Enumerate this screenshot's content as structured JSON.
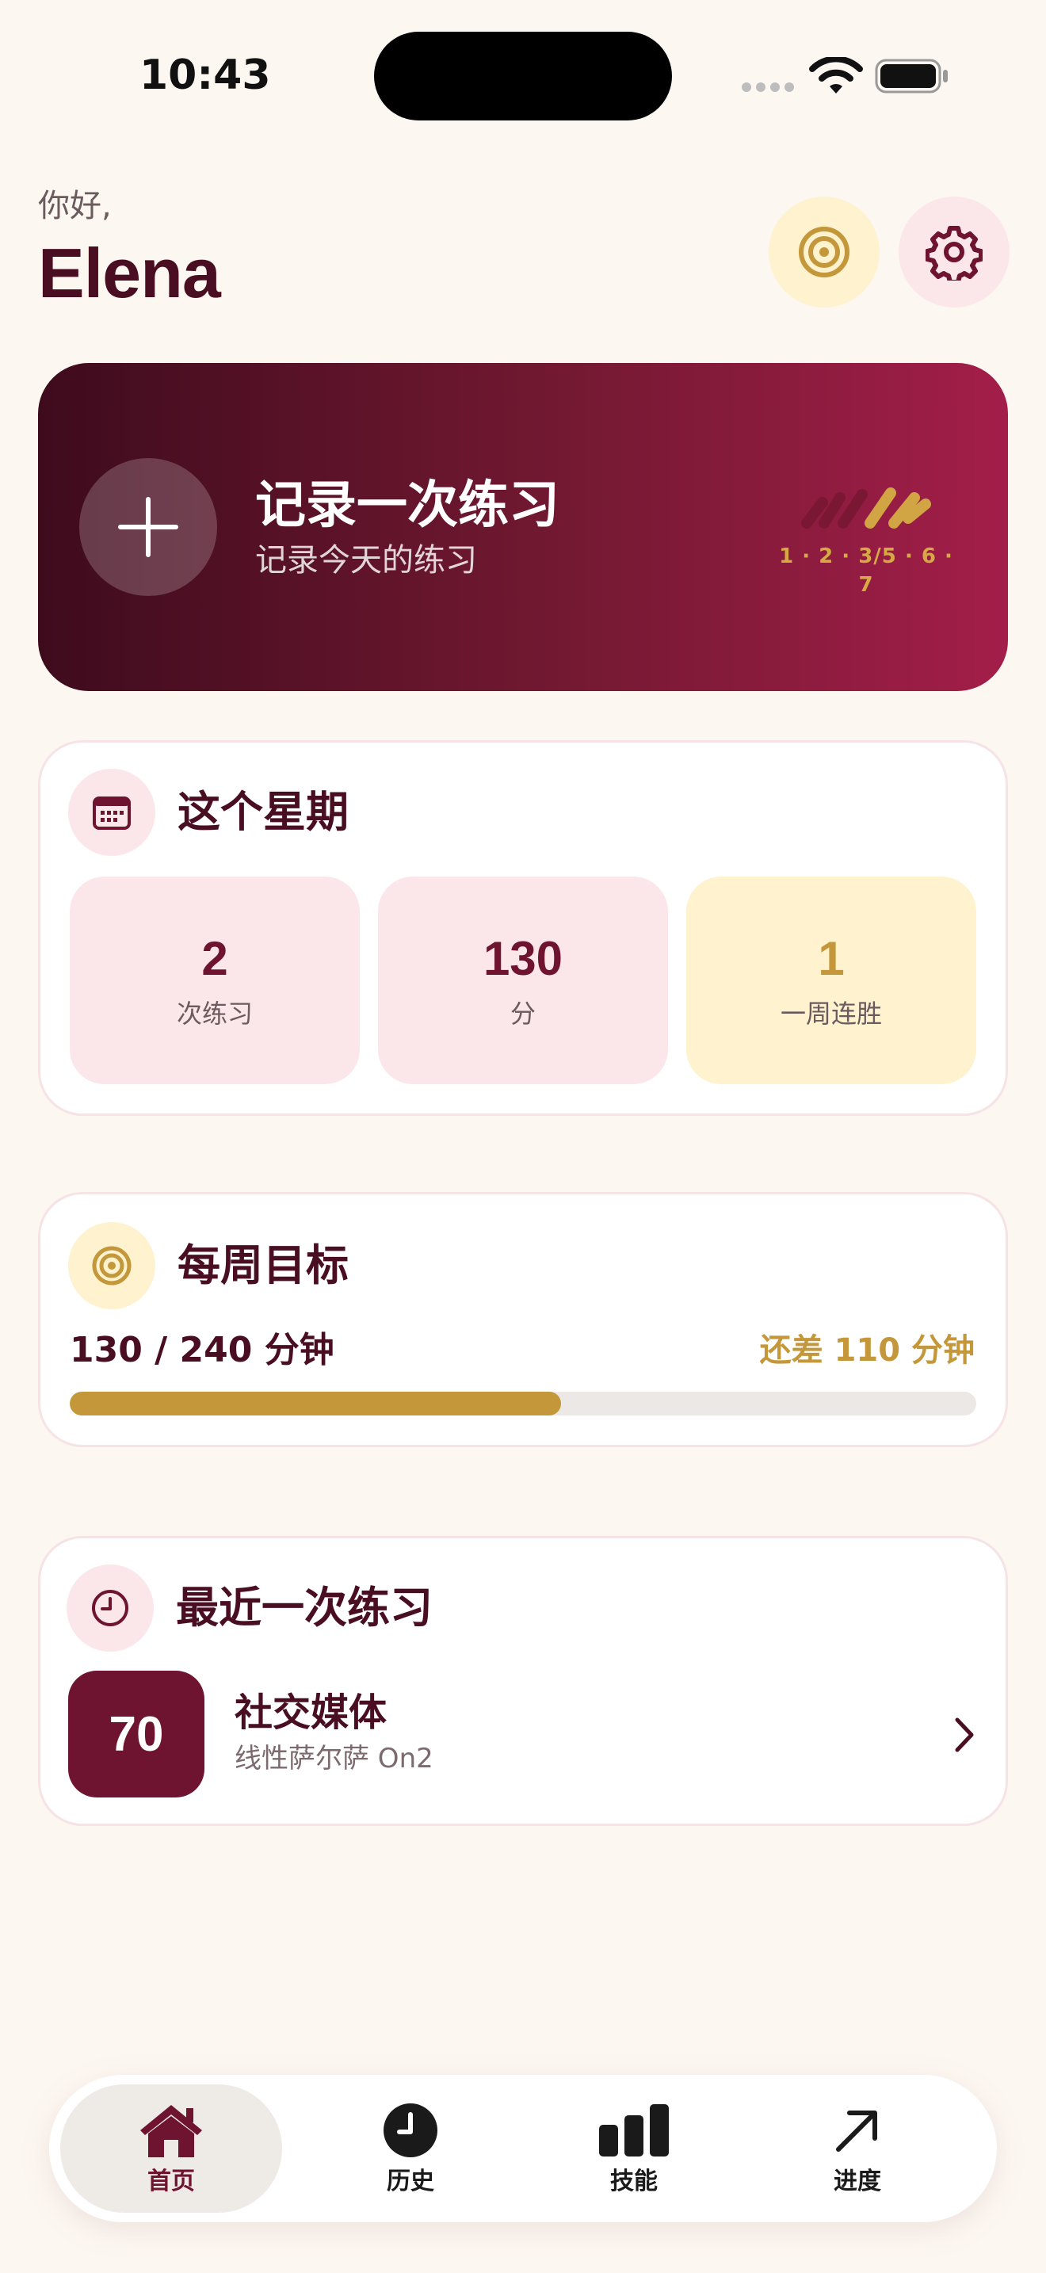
{
  "status_bar": {
    "time": "10:43"
  },
  "header": {
    "greeting": "你好,",
    "name": "Elena"
  },
  "hero": {
    "title": "记录一次练习",
    "subtitle": "记录今天的练习",
    "count_label": "1 · 2 · 3/5 · 6 · 7"
  },
  "week": {
    "title": "这个星期",
    "stats": [
      {
        "value": "2",
        "label": "次练习"
      },
      {
        "value": "130",
        "label": "分"
      },
      {
        "value": "1",
        "label": "一周连胜"
      }
    ]
  },
  "goal": {
    "title": "每周目标",
    "progress_text": "130 / 240 分钟",
    "remaining_text": "还差 110 分钟",
    "progress_fraction": 0.5417
  },
  "last": {
    "title": "最近一次练习",
    "score": "70",
    "name": "社交媒体",
    "detail": "线性萨尔萨 On2"
  },
  "tabs": [
    {
      "label": "首页",
      "icon": "home-icon",
      "active": true
    },
    {
      "label": "历史",
      "icon": "clock-icon",
      "active": false
    },
    {
      "label": "技能",
      "icon": "bar-chart-icon",
      "active": false
    },
    {
      "label": "进度",
      "icon": "arrow-up-right-icon",
      "active": false
    }
  ],
  "colors": {
    "background": "#FDF7F2",
    "primary": "#6E1430",
    "gold": "#C3973A",
    "pink_tint": "#FBE7EA",
    "cream_tint": "#FEF2CF"
  }
}
